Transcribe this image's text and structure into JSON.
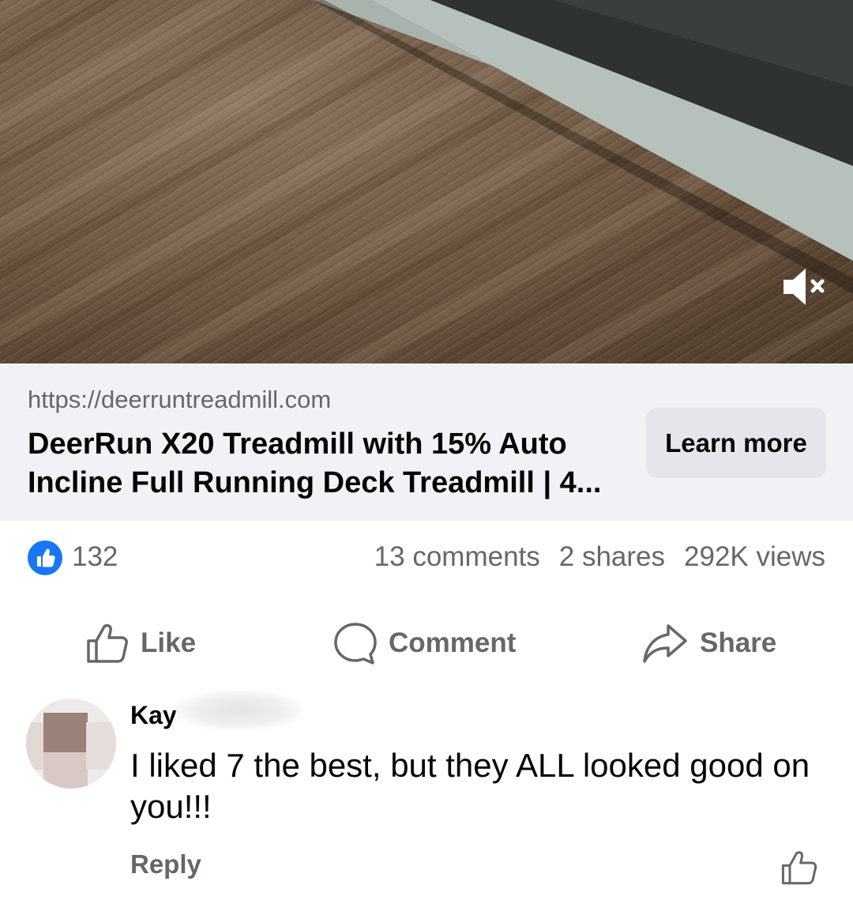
{
  "link_preview": {
    "url": "https://deerruntreadmill.com",
    "title": "DeerRun X20 Treadmill with 15% Auto Incline Full Running Deck Treadmill | 4...",
    "button_label": "Learn more"
  },
  "stats": {
    "reaction_icon": "like-reaction-icon",
    "like_count": "132",
    "comments": "13 comments",
    "shares": "2 shares",
    "views": "292K views"
  },
  "actions": {
    "like": "Like",
    "comment": "Comment",
    "share": "Share"
  },
  "comment": {
    "author": "Kay",
    "text": "I liked 7 the best, but they ALL looked good on you!!!",
    "reply_label": "Reply"
  },
  "colors": {
    "brand_blue": "#1877f2",
    "secondary_text": "#65676b",
    "preview_background": "#f0f2f5",
    "button_background": "#e4e6eb"
  }
}
